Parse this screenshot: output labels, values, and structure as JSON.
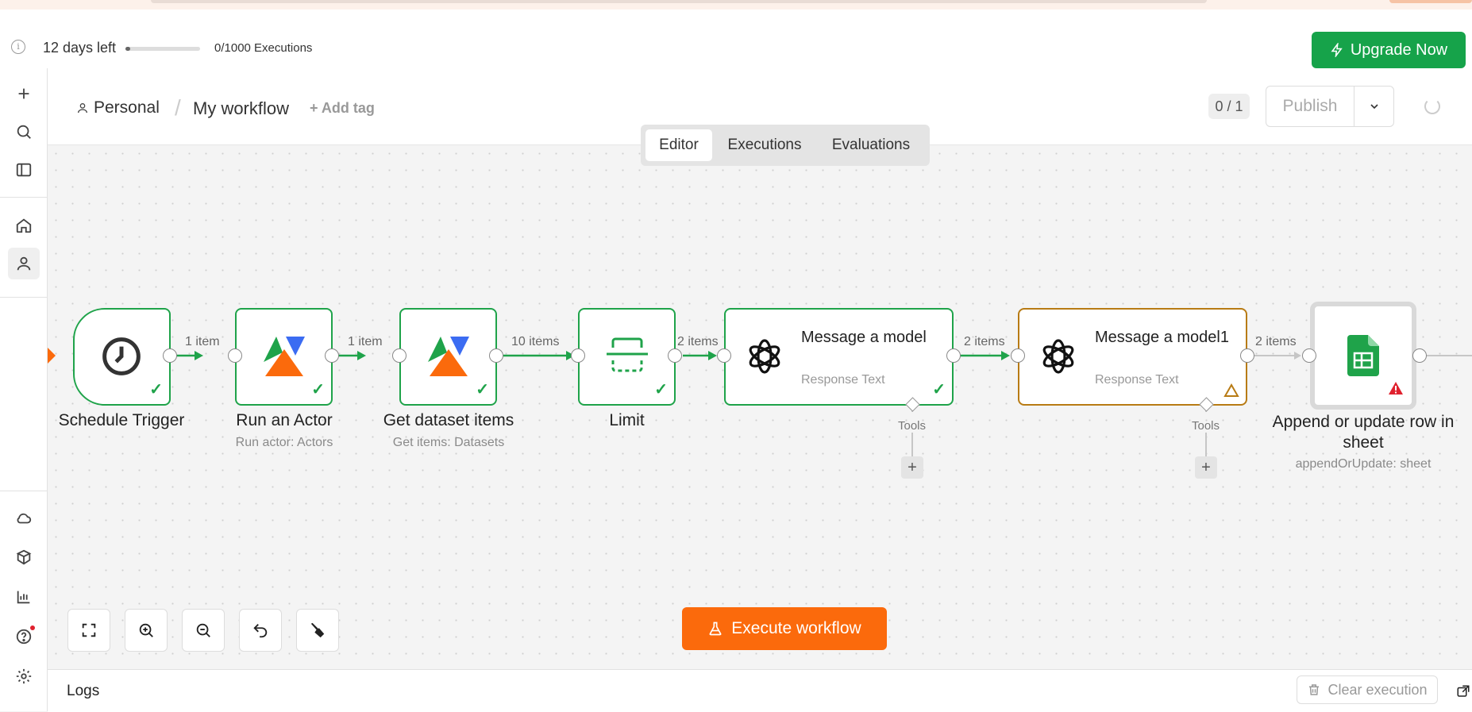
{
  "trial": {
    "days_left": "12 days left",
    "executions": "0/1000 Executions",
    "upgrade_label": "Upgrade Now",
    "progress_fraction": 0.0
  },
  "header": {
    "project": "Personal",
    "separator": "/",
    "workflow_name": "My workflow",
    "add_tag": "+ Add tag",
    "counter": "0 / 1",
    "publish_label": "Publish"
  },
  "tabs": [
    {
      "label": "Editor",
      "active": true
    },
    {
      "label": "Executions",
      "active": false
    },
    {
      "label": "Evaluations",
      "active": false
    }
  ],
  "nodes": [
    {
      "id": "schedule",
      "label": "Schedule Trigger",
      "subtitle": "",
      "icon": "clock-icon",
      "status": "success"
    },
    {
      "id": "run-actor",
      "label": "Run an Actor",
      "subtitle": "Run actor: Actors",
      "icon": "apify-icon",
      "status": "success"
    },
    {
      "id": "get-dataset",
      "label": "Get dataset items",
      "subtitle": "Get items: Datasets",
      "icon": "apify-icon",
      "status": "success"
    },
    {
      "id": "limit",
      "label": "Limit",
      "subtitle": "",
      "icon": "limit-icon",
      "status": "success"
    },
    {
      "id": "message-model",
      "title": "Message a model",
      "subtitle": "Response Text",
      "sub_label": "Tools",
      "icon": "openai-icon",
      "status": "success"
    },
    {
      "id": "message-model1",
      "title": "Message a model1",
      "subtitle": "Response Text",
      "sub_label": "Tools",
      "icon": "openai-icon",
      "status": "warning"
    },
    {
      "id": "append-sheet",
      "label": "Append or update row in sheet",
      "subtitle": "appendOrUpdate: sheet",
      "icon": "google-sheets-icon",
      "status": "error"
    }
  ],
  "edges": [
    "1 item",
    "1 item",
    "10 items",
    "2 items",
    "2 items",
    "2 items"
  ],
  "canvas_controls": [
    "fit-view",
    "zoom-in",
    "zoom-out",
    "undo",
    "tidy-up"
  ],
  "execute_label": "Execute workflow",
  "logs": {
    "label": "Logs",
    "clear_label": "Clear execution"
  },
  "colors": {
    "success": "#1fa34a",
    "warning": "#b87b14",
    "error": "#e0212e",
    "execute": "#fb6a0c",
    "upgrade": "#16a34a"
  }
}
